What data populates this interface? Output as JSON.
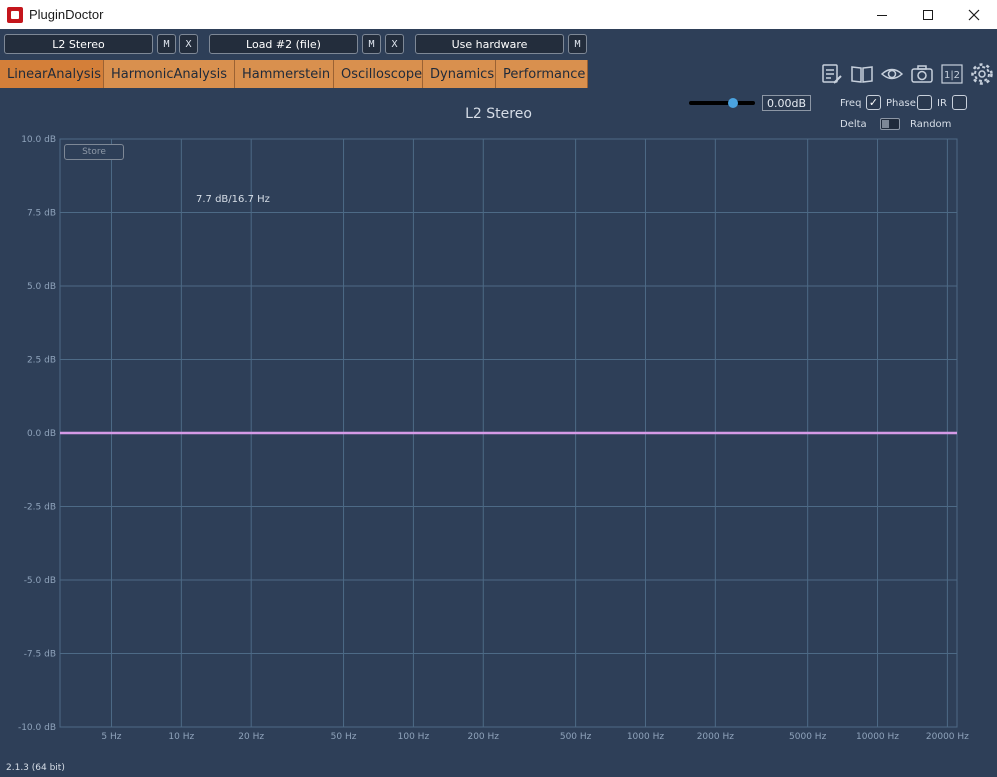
{
  "window": {
    "title": "PluginDoctor"
  },
  "slots": {
    "plugin1": {
      "label": "L2 Stereo",
      "m": "M",
      "x": "X"
    },
    "plugin2": {
      "label": "Load #2 (file)",
      "m": "M",
      "x": "X"
    },
    "hardware": {
      "label": "Use hardware",
      "m": "M"
    }
  },
  "tabs": [
    {
      "label": "LinearAnalysis",
      "active": true
    },
    {
      "label": "HarmonicAnalysis"
    },
    {
      "label": "Hammerstein"
    },
    {
      "label": "Oscilloscope"
    },
    {
      "label": "Dynamics"
    },
    {
      "label": "Performance"
    }
  ],
  "toolbar": {
    "icons": [
      "notes-icon",
      "book-icon",
      "eye-icon",
      "camera-icon",
      "split-view-icon",
      "gear-icon"
    ],
    "split_label": "1|2"
  },
  "controls": {
    "gain_value": "0.00dB",
    "gain_slider_fraction": 0.7,
    "freq_label": "Freq",
    "freq_checked": true,
    "phase_label": "Phase",
    "phase_checked": false,
    "ir_label": "IR",
    "ir_checked": false,
    "delta_label": "Delta",
    "random_label": "Random"
  },
  "store_label": "Store",
  "cursor_readout": "7.7 dB/16.7 Hz",
  "version": "2.1.3 (64 bit)",
  "colors": {
    "background": "#2e3f58",
    "grid": "#4d6a86",
    "tab": "#d9904e",
    "trace": "#d59ae6",
    "accent": "#4aa3e0"
  },
  "chart_data": {
    "type": "line",
    "title": "L2 Stereo",
    "xscale": "log",
    "xlim": [
      3,
      22000
    ],
    "ylim": [
      -10,
      10
    ],
    "y_ticks": [
      10,
      7.5,
      5,
      2.5,
      0,
      -2.5,
      -5,
      -7.5,
      -10
    ],
    "y_tick_labels": [
      "10.0 dB",
      "7.5 dB",
      "5.0 dB",
      "2.5 dB",
      "0.0 dB",
      "-2.5 dB",
      "-5.0 dB",
      "-7.5 dB",
      "-10.0 dB"
    ],
    "x_ticks": [
      5,
      10,
      20,
      50,
      100,
      200,
      500,
      1000,
      2000,
      5000,
      10000,
      20000
    ],
    "x_tick_labels": [
      "5 Hz",
      "10 Hz",
      "20 Hz",
      "50 Hz",
      "100 Hz",
      "200 Hz",
      "500 Hz",
      "1000 Hz",
      "2000 Hz",
      "5000 Hz",
      "10000 Hz",
      "20000 Hz"
    ],
    "grid": true,
    "series": [
      {
        "x": [
          3,
          10,
          100,
          1000,
          10000,
          22000
        ],
        "y": [
          0,
          0,
          0,
          0,
          0,
          0
        ]
      }
    ]
  }
}
